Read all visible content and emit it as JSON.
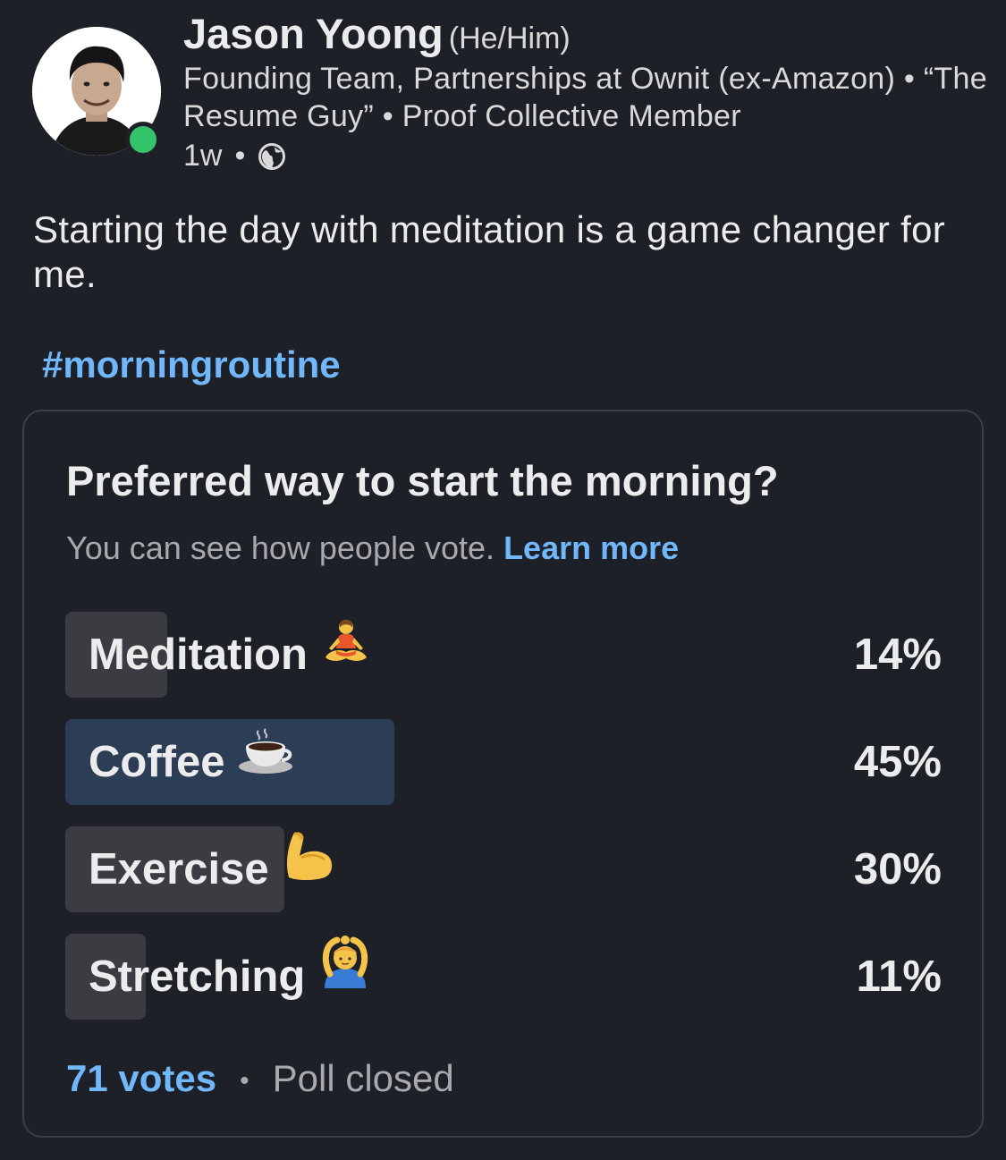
{
  "author": {
    "name": "Jason Yoong",
    "pronouns": "(He/Him)",
    "headline": "Founding Team, Partnerships at Ownit (ex-Amazon) • “The Resume Guy” • Proof Collective Member",
    "time_ago": "1w",
    "separator": "•",
    "visibility_icon": "globe-icon",
    "online_status_color": "#34c26b"
  },
  "post": {
    "text": "Starting the day with meditation is a game changer for me.",
    "hashtag": "#morningroutine"
  },
  "poll": {
    "question": "Preferred way to start the morning?",
    "visibility_text": "You can see how people vote.",
    "learn_more": "Learn more",
    "options": [
      {
        "label": "Meditation",
        "emoji": "person-in-lotus-position",
        "percent_label": "14%",
        "percent": 14
      },
      {
        "label": "Coffee",
        "emoji": "hot-beverage",
        "percent_label": "45%",
        "percent": 45
      },
      {
        "label": "Exercise",
        "emoji": "flexed-biceps",
        "percent_label": "30%",
        "percent": 30
      },
      {
        "label": "Stretching",
        "emoji": "person-gesturing-ok",
        "percent_label": "11%",
        "percent": 11
      }
    ],
    "votes": "71 votes",
    "footer_separator": "•",
    "status": "Poll closed"
  },
  "colors": {
    "background": "#1d2027",
    "link": "#71b7fb",
    "bar": "#3a3c42",
    "bar_top_choice": "#2c3e55",
    "muted_text": "#a8a9ad"
  }
}
